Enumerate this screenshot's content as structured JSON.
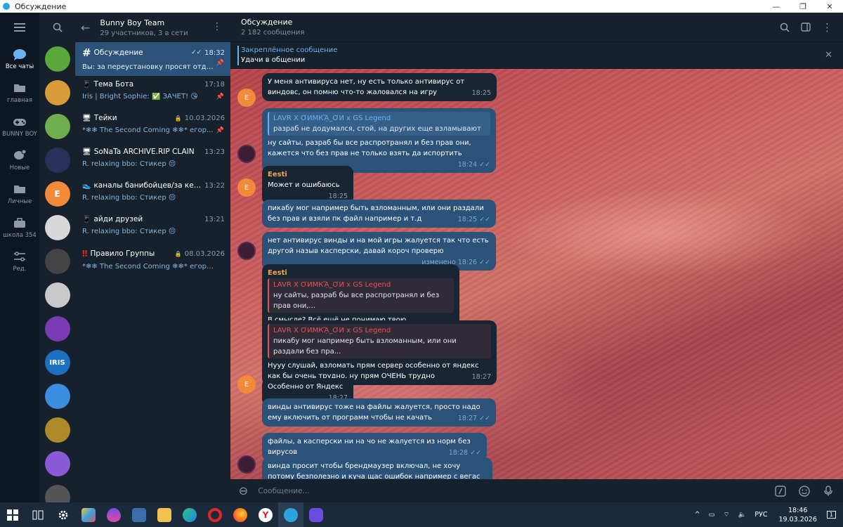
{
  "window": {
    "title": "Обсуждение",
    "min": "—",
    "max": "❐",
    "close": "✕"
  },
  "folders": [
    {
      "label": "Все чаты",
      "icon": "chat-bubble-icon",
      "active": true
    },
    {
      "label": "главная",
      "icon": "folder-icon"
    },
    {
      "label": "BUNNY BOY",
      "icon": "gamepad-icon"
    },
    {
      "label": "Новые",
      "icon": "new-chat-icon"
    },
    {
      "label": "Личные",
      "icon": "folder-icon"
    },
    {
      "label": "школа 354",
      "icon": "briefcase-icon"
    },
    {
      "label": "Ред.",
      "icon": "sliders-icon"
    }
  ],
  "avatars": [
    {
      "color": "#5aa83a",
      "text": ""
    },
    {
      "color": "#d99a3a",
      "text": ""
    },
    {
      "color": "#6fae4f",
      "text": ""
    },
    {
      "color": "#2b2f5a",
      "text": ""
    },
    {
      "color": "#f28a3a",
      "text": "E"
    },
    {
      "color": "#d8d8d8",
      "text": ""
    },
    {
      "color": "#444",
      "text": ""
    },
    {
      "color": "#c9c9c9",
      "text": ""
    },
    {
      "color": "#7a3bb5",
      "text": ""
    },
    {
      "color": "#1d6fc2",
      "text": "IRIS"
    },
    {
      "color": "#3b8de0",
      "text": ""
    },
    {
      "color": "#b08a2a",
      "text": ""
    },
    {
      "color": "#8a5ad6",
      "text": ""
    },
    {
      "color": "#555",
      "text": ""
    }
  ],
  "chatlist": {
    "title": "Bunny Boy Team",
    "subtitle": "29 участников, 3 в сети",
    "items": [
      {
        "icon": "#",
        "name": "Обсуждение",
        "time": "18:32",
        "preview": "Вы: за переустановку просят отдат...",
        "selected": true,
        "pinned": true,
        "check": "✓✓"
      },
      {
        "icon": "📱",
        "name": "Тема Бота",
        "time": "17:18",
        "preview": "Iris | Bright Sophie: ✅ ЗАЧЁТ! 😘",
        "pinned": true
      },
      {
        "icon": "🖥",
        "name": "Тейки",
        "time": "10.03.2026",
        "preview": "*❄❄ The Second Coming ❄❄* егор...",
        "pinned": true,
        "locked": true
      },
      {
        "icon": "🖥",
        "name": "SoNaTa ARCHIVE.RIP CLAIN",
        "time": "13:23",
        "preview": "R. relaxing bbo: Стикер 😔"
      },
      {
        "icon": "👟",
        "name": "каналы банибойцев/за кем после...",
        "time": "13:22",
        "preview": "R. relaxing bbo: Стикер 😔"
      },
      {
        "icon": "📱",
        "name": "айди друзей",
        "time": "13:21",
        "preview": "R. relaxing bbo: Стикер 😔"
      },
      {
        "icon": "‼",
        "name": "Правило Группы",
        "time": "08.03.2026",
        "preview": "*❄❄ The Second Coming ❄❄* егорушка...",
        "locked": true
      }
    ]
  },
  "chat": {
    "title": "Обсуждение",
    "subtitle": "2 182 сообщения",
    "pinned_label": "Закреплённое сообщение",
    "pinned_text": "Удачи в общении",
    "input_placeholder": "Сообщение..."
  },
  "messages": [
    {
      "side": "in",
      "text": "У меня антивируса нет, ну есть только антивирус от виндовс, он помню что-то жаловался на игру",
      "time": "18:25"
    },
    {
      "side": "out",
      "quote_name": "LAVR X ƠИМКᾍ_ƠИ x GS Legend",
      "quote_text": "разраб не додумался, стой, на других еще взламывают",
      "text": "ну сайты, разраб бы все распротранял и без прав они, кажется что без прав не только взять да испортить",
      "time": "18:24",
      "check": "✓✓"
    },
    {
      "side": "in",
      "sender": "Eesti",
      "text": "Может и ошибаюсь",
      "time": "18:25"
    },
    {
      "side": "out",
      "text": "пикабу мог например быть взломанным, или они раздали без прав и взяли пк файл например и т.д",
      "time": "18:25",
      "check": "✓✓"
    },
    {
      "side": "out",
      "text": "нет антивирус винды и на мой игры жалуется так что есть другой назыв касперски, давай короч проверю",
      "time": "изменено 18:26",
      "check": "✓✓"
    },
    {
      "side": "in",
      "sender": "Eesti",
      "quote_name": "LAVR X ƠИМКᾍ_ƠИ x GS Legend",
      "quote_text": "ну сайты, разраб бы все распротранял и без прав они,...",
      "text": "В смысле? Всё ещё не понимаю твою формулировку.",
      "time": "18:27"
    },
    {
      "side": "in",
      "quote_name": "LAVR X ƠИМКᾍ_ƠИ x GS Legend",
      "quote_text": "пикабу мог например быть взломанным, или они раздали без пра...",
      "text": "Нууу слушай, взломать прям сервер особенно от яндекс как бы очень трудно, ну прям ОЧЕНЬ трудно",
      "time": "18:27"
    },
    {
      "side": "in",
      "text": "Особенно от Яндекс",
      "time": "18:27"
    },
    {
      "side": "out",
      "text": "винды антивирус тоже на файлы жалуется, просто надо ему включить от программ чтобы не качать",
      "time": "18:27",
      "check": "✓✓"
    },
    {
      "side": "out",
      "text": "файлы, а касперски ни на чо не жалуется из норм без вирусов",
      "time": "18:28",
      "check": "✓✓"
    },
    {
      "side": "out",
      "text": "винда просит чтобы брендмаузер включал, не хочу потому безполезно и куча щас ошибок например с вегас про придет то что",
      "time": ""
    }
  ],
  "taskbar": {
    "lang": "РУС",
    "time": "18:46",
    "date": "19.03.2026",
    "notif": "1"
  }
}
